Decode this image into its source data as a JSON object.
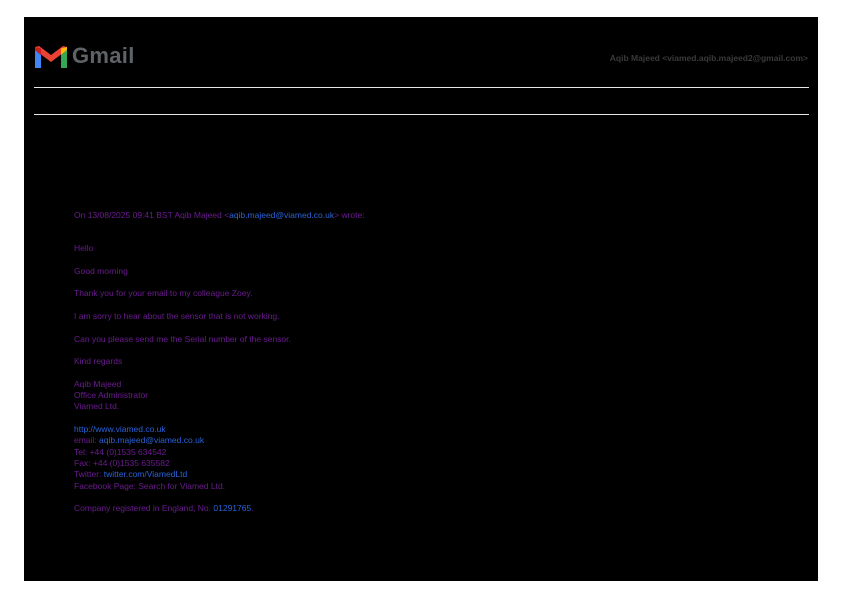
{
  "header": {
    "brand": "Gmail",
    "account": "Aqib Majeed <viamed.aqib.majeed2@gmail.com>"
  },
  "email": {
    "quote_prefix": "On 13/08/2025 09:41 BST Aqib Majeed <",
    "quote_email": "aqib.majeed@viamed.co.uk",
    "quote_suffix": "> wrote:",
    "greeting": "Hello",
    "morning": "Good morning",
    "line1": "Thank you for your email to my colleague Zoey.",
    "line2": "I am sorry to hear about the sensor that is not working.",
    "line3": "Can you please send me the Serial number of the sensor.",
    "signoff": "Kind regards",
    "sig_name": "Aqib Majeed",
    "sig_title": "Office Administrator",
    "sig_company": "Viamed Ltd.",
    "website": "http://www.viamed.co.uk",
    "email_label": "email: ",
    "email_value": "aqib.majeed@viamed.co.uk",
    "tel": "Tel: +44 (0)1535 634542",
    "fax": "Fax: +44 (0)1535 635582",
    "twitter_label": "Twitter: ",
    "twitter_value": "twitter.com/ViamedLtd",
    "facebook": "Facebook Page: Search for Viamed Ltd.",
    "company_reg_label": "Company registered in England, No. ",
    "company_reg_number": "01291765",
    "company_reg_end": "."
  },
  "colors": {
    "background": "#000000",
    "text_purple": "#6a1b8f",
    "link_blue": "#2a63d8",
    "rule": "#e6e6e6"
  }
}
